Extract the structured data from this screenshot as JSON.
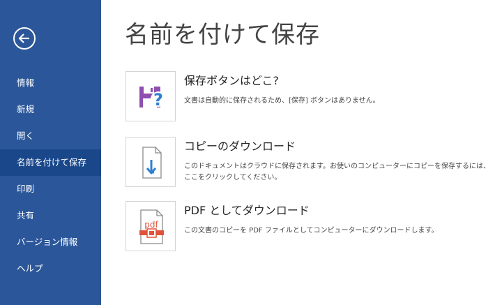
{
  "sidebar": {
    "back_icon": "back-arrow-icon",
    "items": [
      {
        "label": "情報"
      },
      {
        "label": "新規"
      },
      {
        "label": "開く"
      },
      {
        "label": "名前を付けて保存"
      },
      {
        "label": "印刷"
      },
      {
        "label": "共有"
      },
      {
        "label": "バージョン情報"
      },
      {
        "label": "ヘルプ"
      }
    ],
    "active_item": "名前を付けて保存"
  },
  "main": {
    "title": "名前を付けて保存",
    "options": [
      {
        "icon": "save-question-icon",
        "title": "保存ボタンはどこ?",
        "description": "文書は自動的に保存されるため、[保存] ボタンはありません。"
      },
      {
        "icon": "download-document-icon",
        "title": "コピーのダウンロード",
        "description": "このドキュメントはクラウドに保存されます。お使いのコンピューターにコピーを保存するには、ここをクリックしてください。"
      },
      {
        "icon": "pdf-icon",
        "title": "PDF としてダウンロード",
        "description": "この文書のコピーを PDF ファイルとしてコンピューターにダウンロードします。",
        "icon_text": "pdf"
      }
    ]
  },
  "colors": {
    "sidebar_bg": "#2b579a",
    "sidebar_active": "#19478a",
    "save_icon_purple": "#9b59b6",
    "download_arrow_blue": "#2f7fd1",
    "pdf_red": "#e0523a"
  }
}
